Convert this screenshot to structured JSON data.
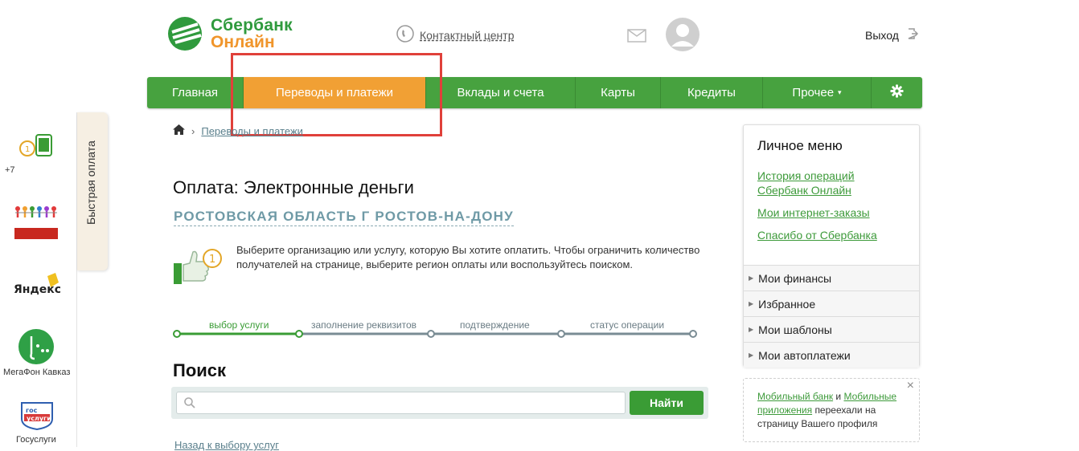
{
  "header": {
    "logo_line1": "Сбербанк",
    "logo_line2": "Онлайн",
    "contact_center": "Контактный центр",
    "exit": "Выход"
  },
  "nav": {
    "items": [
      {
        "label": "Главная"
      },
      {
        "label": "Переводы и платежи"
      },
      {
        "label": "Вклады и счета"
      },
      {
        "label": "Карты"
      },
      {
        "label": "Кредиты"
      },
      {
        "label": "Прочее"
      }
    ],
    "active_index": 1,
    "dropdown_marker": "▾"
  },
  "breadcrumb": {
    "current": "Переводы и платежи"
  },
  "quick_pay": {
    "tab_label": "Быстрая оплата",
    "items": [
      {
        "label": "+7",
        "icon": "phone-icon"
      },
      {
        "label": "",
        "icon": "charity-icon"
      },
      {
        "label": "",
        "icon": "yandex-icon"
      },
      {
        "label": "МегаФон Кавказ",
        "icon": "megafon-icon"
      },
      {
        "label": "Госуслуги",
        "icon": "gosuslugi-icon"
      }
    ]
  },
  "main": {
    "title": "Оплата: Электронные деньги",
    "region": "РОСТОВСКАЯ ОБЛАСТЬ Г РОСТОВ-НА-ДОНУ",
    "intro": "Выберите организацию или услугу, которую Вы хотите оплатить. Чтобы ограничить количество получателей на странице, выберите регион оплаты или воспользуйтесь поиском.",
    "steps": [
      "выбор услуги",
      "заполнение реквизитов",
      "подтверждение",
      "статус операции"
    ],
    "current_step": 1,
    "search_title": "Поиск",
    "search_placeholder": "",
    "search_button": "Найти",
    "back_link": "Назад к выбору услуг"
  },
  "personal_menu": {
    "title": "Личное меню",
    "links": [
      "История операций Сбербанк Онлайн",
      "Мои интернет-заказы",
      "Спасибо от Сбербанка"
    ],
    "sections": [
      "Мои финансы",
      "Избранное",
      "Мои шаблоны",
      "Мои автоплатежи"
    ]
  },
  "notice": {
    "link1": "Мобильный банк",
    "conj": "и",
    "link2": "Мобильные приложения",
    "text": "переехали на страницу Вашего профиля",
    "close": "×"
  },
  "colors": {
    "brand_green": "#47a23f",
    "brand_orange": "#f1a034",
    "highlight_red": "#e0403a"
  }
}
